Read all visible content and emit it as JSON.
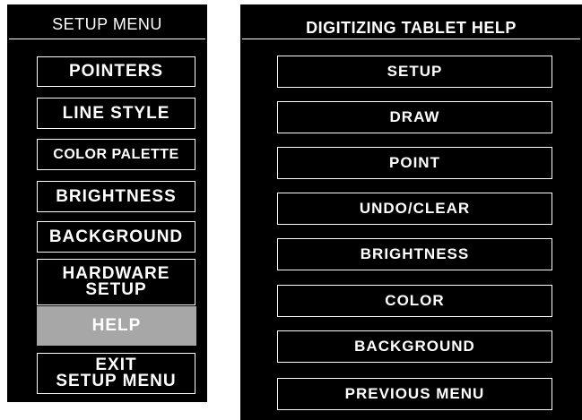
{
  "setup_menu": {
    "title": "SETUP MENU",
    "items": [
      {
        "label": "POINTERS",
        "active": false
      },
      {
        "label": "LINE STYLE",
        "active": false
      },
      {
        "label": "COLOR PALETTE",
        "active": false
      },
      {
        "label": "BRIGHTNESS",
        "active": false
      },
      {
        "label": "BACKGROUND",
        "active": false
      },
      {
        "label": "HARDWARE\nSETUP",
        "active": false
      },
      {
        "label": "HELP",
        "active": true
      },
      {
        "label": "EXIT\nSETUP MENU",
        "active": false
      }
    ]
  },
  "help_menu": {
    "title": "DIGITIZING TABLET HELP",
    "items": [
      {
        "label": "SETUP"
      },
      {
        "label": "DRAW"
      },
      {
        "label": "POINT"
      },
      {
        "label": "UNDO/CLEAR"
      },
      {
        "label": "BRIGHTNESS"
      },
      {
        "label": "COLOR"
      },
      {
        "label": "BACKGROUND"
      },
      {
        "label": "PREVIOUS MENU"
      }
    ]
  },
  "colors": {
    "panel_background": "#000000",
    "text": "#ffffff",
    "active_item": "#a7a7a7",
    "page_background": "#ffffff"
  }
}
